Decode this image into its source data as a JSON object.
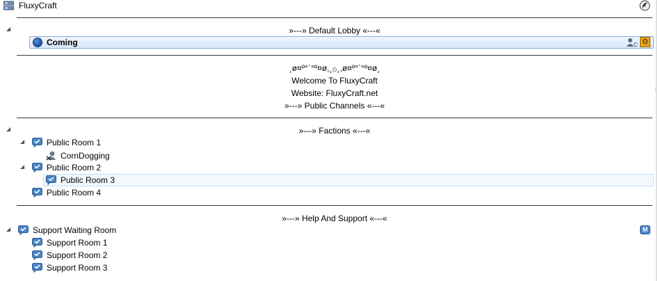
{
  "server": {
    "name": "FluxyCraft"
  },
  "sections": {
    "default_lobby": "»---»  Default Lobby «---«",
    "factions": "»---»  Factions «---«",
    "help_support": "»---»  Help And Support «---«"
  },
  "lobby_client": {
    "name": "Coming"
  },
  "welcome": {
    "decoration": "¸ø¤º°`°º¤ø,¸۞¸,ø¤º°`°º¤ø¸",
    "line1": "Welcome To FluxyCraft",
    "line2": "Website: FluxyCraft.net",
    "line3": "»---»  Public Channels «---«"
  },
  "channels": {
    "public_room_1": "Public Room 1",
    "corndogging": "CornDogging",
    "public_room_2": "Public Room 2",
    "public_room_3": "Public Room 3",
    "public_room_4": "Public Room 4",
    "support_waiting_room": "Support Waiting Room",
    "support_room_1": "Support Room 1",
    "support_room_2": "Support Room 2",
    "support_room_3": "Support Room 3"
  },
  "badges": {
    "client_badge": "C",
    "server_group_badge": "O",
    "moderated_badge": "M"
  },
  "colors": {
    "selection_border": "#84acdd",
    "channel_icon": "#3f78b9",
    "separator": "#3a3a3a"
  }
}
